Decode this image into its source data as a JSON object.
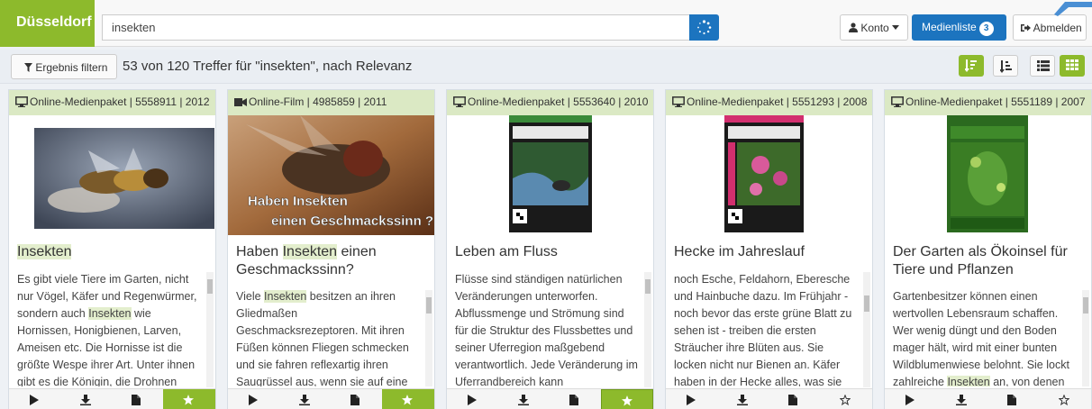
{
  "brand": "Düsseldorf",
  "search": {
    "value": "insekten"
  },
  "header": {
    "konto_label": "Konto",
    "medienliste_label": "Medienliste",
    "medienliste_count": "3",
    "abmelden_label": "Abmelden"
  },
  "filterbar": {
    "filter_label": "Ergebnis filtern",
    "result_text": "53 von 120 Treffer für \"insekten\", nach Relevanz"
  },
  "colors": {
    "brand_green": "#8dba2c",
    "primary_blue": "#1c74bf",
    "card_header_bg": "#dbe9c4"
  },
  "cards": [
    {
      "type_icon": "monitor-icon",
      "header": "Online-Medienpaket | 5558911 | 2012",
      "title_pre": "",
      "title_hl": "Insekten",
      "title_post": "",
      "desc_pre": "Es gibt viele Tiere im Garten, nicht nur Vögel, Käfer und Regenwürmer, sondern auch ",
      "desc_hl": "Insekten",
      "desc_post": " wie Hornissen, Honigbienen, Larven, Ameisen etc. Die Hornisse ist die größte Wespe ihrer Art. Unter ihnen gibt es die Königin, die Drohnen",
      "favorite": true
    },
    {
      "type_icon": "film-camera-icon",
      "header": "Online-Film | 4985859 | 2011",
      "title_pre": "Haben ",
      "title_hl": "Insekten",
      "title_post": " einen Geschmackssinn?",
      "thumb_caption_1": "Haben Insekten",
      "thumb_caption_2": "einen Geschmackssinn ?",
      "desc_pre": "Viele ",
      "desc_hl": "Insekten",
      "desc_post": " besitzen an ihren Gliedmaßen Geschmacksrezeptoren. Mit ihren Füßen können Fliegen schmecken und sie fahren reflexartig ihren Saugrüssel aus, wenn sie auf eine",
      "favorite": true
    },
    {
      "type_icon": "monitor-icon",
      "header": "Online-Medienpaket | 5553640 | 2010",
      "title_pre": "Leben am Fluss",
      "title_hl": "",
      "title_post": "",
      "desc_pre": "Flüsse sind ständigen natürlichen Veränderungen unterworfen. Abflussmenge und Strömung sind für die Struktur des Flussbettes und seiner Uferregion maßgebend verantwortlich. Jede Veränderung im Uferrandbereich kann",
      "desc_hl": "",
      "desc_post": "",
      "favorite": true
    },
    {
      "type_icon": "monitor-icon",
      "header": "Online-Medienpaket | 5551293 | 2008",
      "title_pre": "Hecke im Jahreslauf",
      "title_hl": "",
      "title_post": "",
      "desc_pre": "noch Esche, Feldahorn, Eberesche und Hainbuche dazu. Im Frühjahr - noch bevor das erste grüne Blatt zu sehen ist - treiben die ersten Sträucher ihre Blüten aus. Sie locken nicht nur Bienen an. Käfer haben in der Hecke alles, was sie",
      "desc_hl": "",
      "desc_post": "",
      "favorite": false
    },
    {
      "type_icon": "monitor-icon",
      "header": "Online-Medienpaket | 5551189 | 2007",
      "title_pre": "Der Garten als Ökoinsel für Tiere und Pflanzen",
      "title_hl": "",
      "title_post": "",
      "desc_pre": "Gartenbesitzer können einen wertvollen Lebensraum schaffen. Wer wenig düngt und den Boden mager hält, wird mit einer bunten Wildblumenwiese belohnt. Sie lockt zahlreiche ",
      "desc_hl": "Insekten",
      "desc_post": " an, von denen",
      "favorite": false
    }
  ]
}
